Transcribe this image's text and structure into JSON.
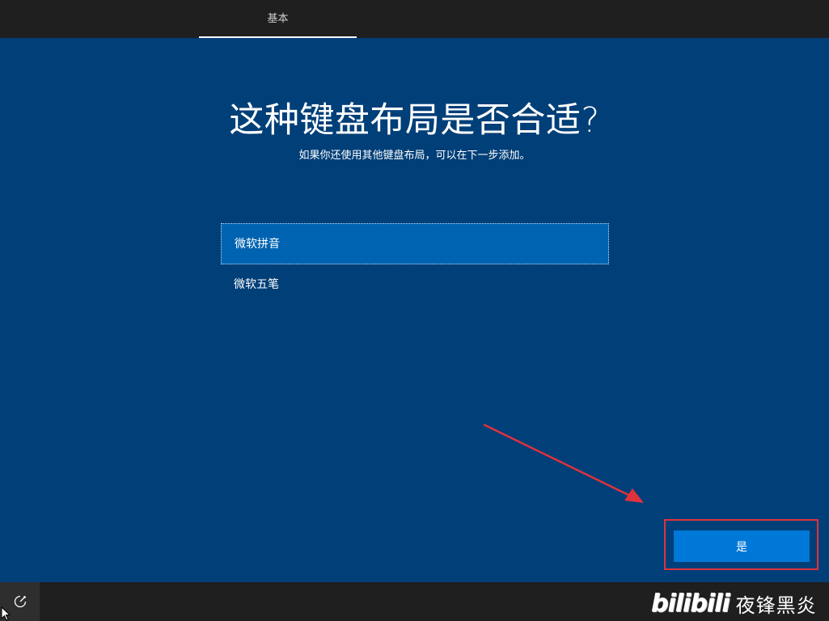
{
  "header": {
    "tab_label": "基本"
  },
  "main": {
    "title": "这种键盘布局是否合适?",
    "subtitle": "如果你还使用其他键盘布局，可以在下一步添加。",
    "layouts": [
      {
        "label": "微软拼音",
        "selected": true
      },
      {
        "label": "微软五笔",
        "selected": false
      }
    ]
  },
  "actions": {
    "yes_label": "是"
  },
  "footer": {
    "accessibility_icon": "ease-of-access-icon"
  },
  "watermark": {
    "logo_text": "bilibili",
    "channel_name": "夜锋黑炎"
  },
  "colors": {
    "background": "#003f78",
    "selected_item": "#0063b1",
    "button": "#0078d7",
    "annotation_red": "#e0323c",
    "bar": "#1f1f1f"
  }
}
